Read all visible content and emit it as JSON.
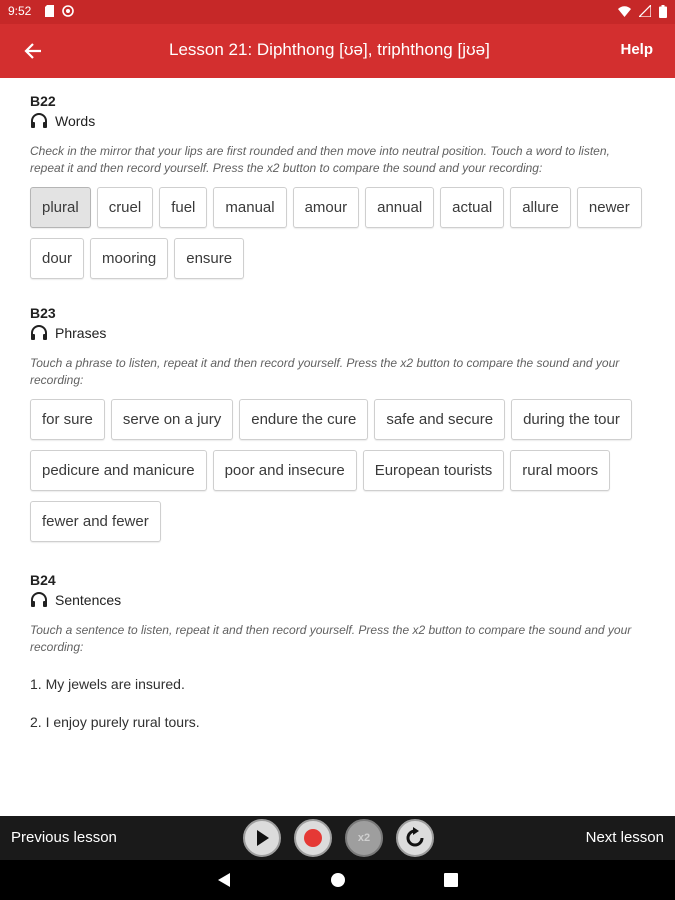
{
  "status_bar": {
    "time": "9:52"
  },
  "app_bar": {
    "title": "Lesson 21: Diphthong [ʊə], triphthong [jʊə]",
    "help_label": "Help"
  },
  "sections": [
    {
      "code": "B22",
      "heading": "Words",
      "instructions": "Check in the mirror that your lips are first rounded and then move into neutral position. Touch a word to listen, repeat it and then record yourself. Press the x2 button to compare the sound and your recording:",
      "items": [
        "plural",
        "cruel",
        "fuel",
        "manual",
        "amour",
        "annual",
        "actual",
        "allure",
        "newer",
        "dour",
        "mooring",
        "ensure"
      ]
    },
    {
      "code": "B23",
      "heading": "Phrases",
      "instructions": "Touch a phrase to listen, repeat it and then record yourself. Press the x2 button to compare the sound and your recording:",
      "items": [
        "for sure",
        "serve on a jury",
        "endure the cure",
        "safe and secure",
        "during the tour",
        "pedicure and manicure",
        "poor and insecure",
        "European tourists",
        "rural moors",
        "fewer and fewer"
      ]
    },
    {
      "code": "B24",
      "heading": "Sentences",
      "instructions": "Touch a sentence to listen, repeat it and then record yourself. Press the x2 button to compare the sound and your recording:",
      "items": [
        "1. My jewels are insured.",
        "2. I enjoy purely rural tours."
      ]
    }
  ],
  "player": {
    "prev_label": "Previous lesson",
    "next_label": "Next lesson",
    "x2_label": "x2",
    "record_color": "#e53935"
  },
  "colors": {
    "app_bar": "#d32f2f",
    "status_bar": "#c62828",
    "player_bar": "#1a1a1a"
  }
}
